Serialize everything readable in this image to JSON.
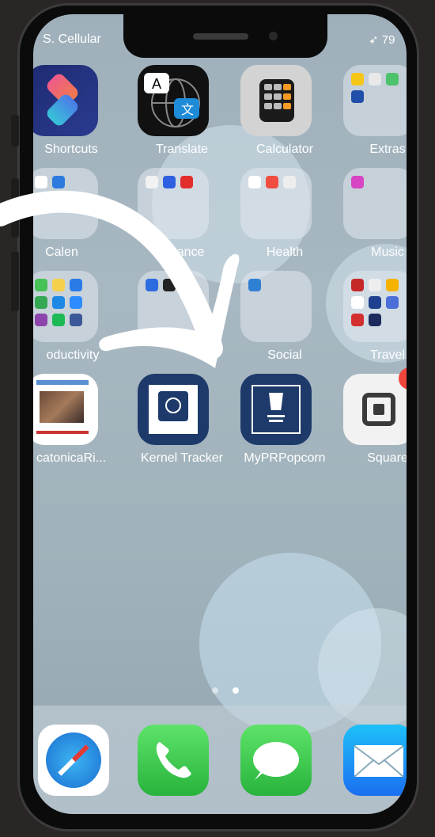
{
  "status_bar": {
    "carrier": "S. Cellular",
    "battery": "79"
  },
  "apps": [
    {
      "label": "Shortcuts",
      "icon": "shortcuts-icon"
    },
    {
      "label": "Translate",
      "icon": "translate-icon"
    },
    {
      "label": "Calculator",
      "icon": "calculator-icon"
    },
    {
      "label": "Extras",
      "icon": "extras-folder-icon"
    },
    {
      "label": "Calen",
      "icon": "calendar-folder-icon"
    },
    {
      "label": "Finance",
      "icon": "finance-folder-icon"
    },
    {
      "label": "Health",
      "icon": "health-folder-icon"
    },
    {
      "label": "Music",
      "icon": "music-folder-icon"
    },
    {
      "label": "oductivity",
      "icon": "productivity-folder-icon"
    },
    {
      "label": "",
      "icon": "shopping-folder-icon"
    },
    {
      "label": "Social",
      "icon": "social-folder-icon"
    },
    {
      "label": "Travel",
      "icon": "travel-folder-icon"
    },
    {
      "label": "catonicaRi...",
      "icon": "catonica-app-icon"
    },
    {
      "label": "Kernel Tracker",
      "icon": "kernel-tracker-icon"
    },
    {
      "label": "MyPRPopcorn",
      "icon": "myprpopcorn-icon"
    },
    {
      "label": "Square",
      "icon": "square-icon"
    }
  ],
  "dock": [
    {
      "icon": "safari-icon"
    },
    {
      "icon": "phone-icon"
    },
    {
      "icon": "messages-icon"
    },
    {
      "icon": "mail-icon"
    }
  ],
  "page_dots": {
    "count": 2,
    "active": 2
  },
  "colors": {
    "annotation_arrow": "#ffffff",
    "badge": "#f0453a",
    "messages": "#34c759",
    "mail": "#1a8cf0"
  }
}
